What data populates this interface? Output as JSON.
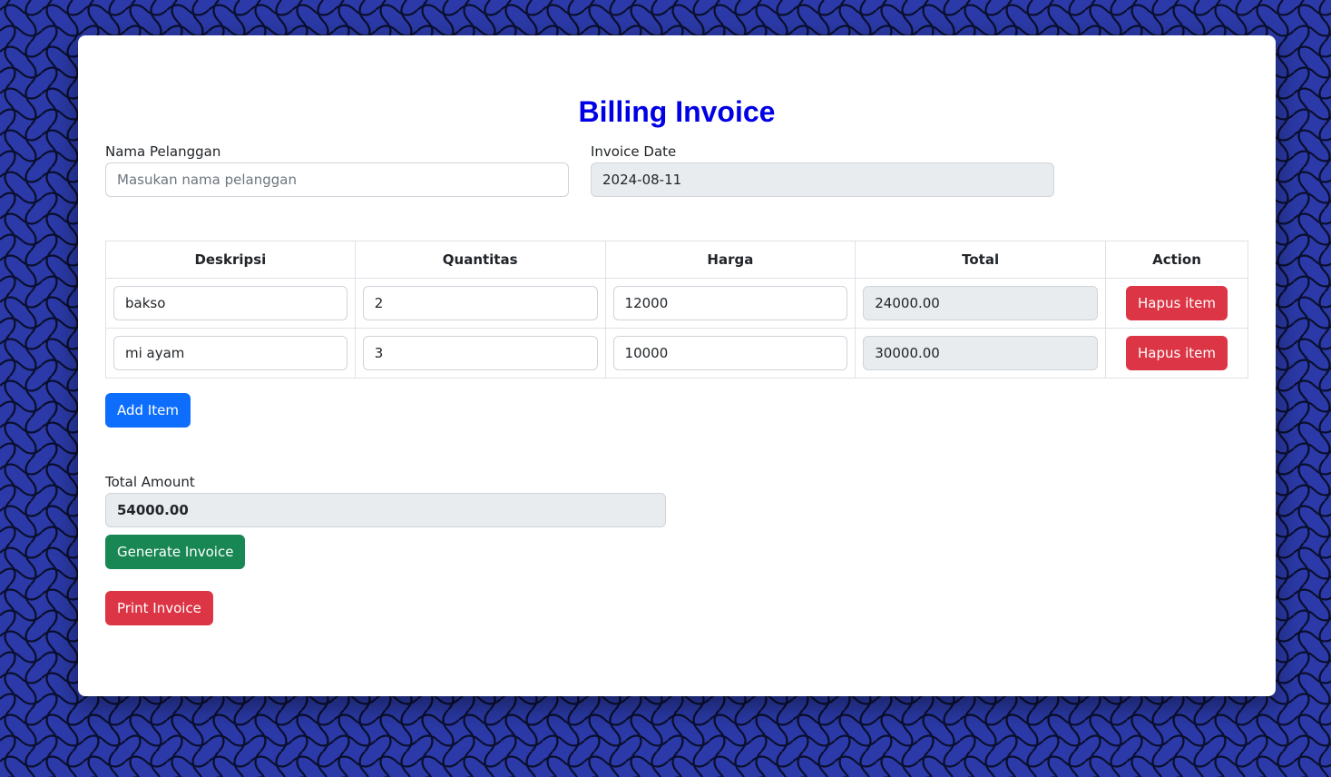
{
  "colors": {
    "background": "#2b3aa8",
    "title": "#0000e6",
    "primary": "#0d6efd",
    "success": "#198754",
    "danger": "#dc3545",
    "readonly_bg": "#e9ecef"
  },
  "invoice": {
    "title": "Billing Invoice",
    "customer": {
      "label": "Nama Pelanggan",
      "placeholder": "Masukan nama pelanggan",
      "value": ""
    },
    "date": {
      "label": "Invoice Date",
      "value": "2024-08-11"
    }
  },
  "table": {
    "headers": [
      "Deskripsi",
      "Quantitas",
      "Harga",
      "Total",
      "Action"
    ],
    "rows": [
      {
        "description": "bakso",
        "quantity": "2",
        "price": "12000",
        "total": "24000.00",
        "action_label": "Hapus item"
      },
      {
        "description": "mi ayam",
        "quantity": "3",
        "price": "10000",
        "total": "30000.00",
        "action_label": "Hapus item"
      }
    ]
  },
  "buttons": {
    "add_item": "Add Item",
    "generate_invoice": "Generate Invoice",
    "print_invoice": "Print Invoice"
  },
  "total_amount": {
    "label": "Total Amount",
    "value": "54000.00"
  }
}
